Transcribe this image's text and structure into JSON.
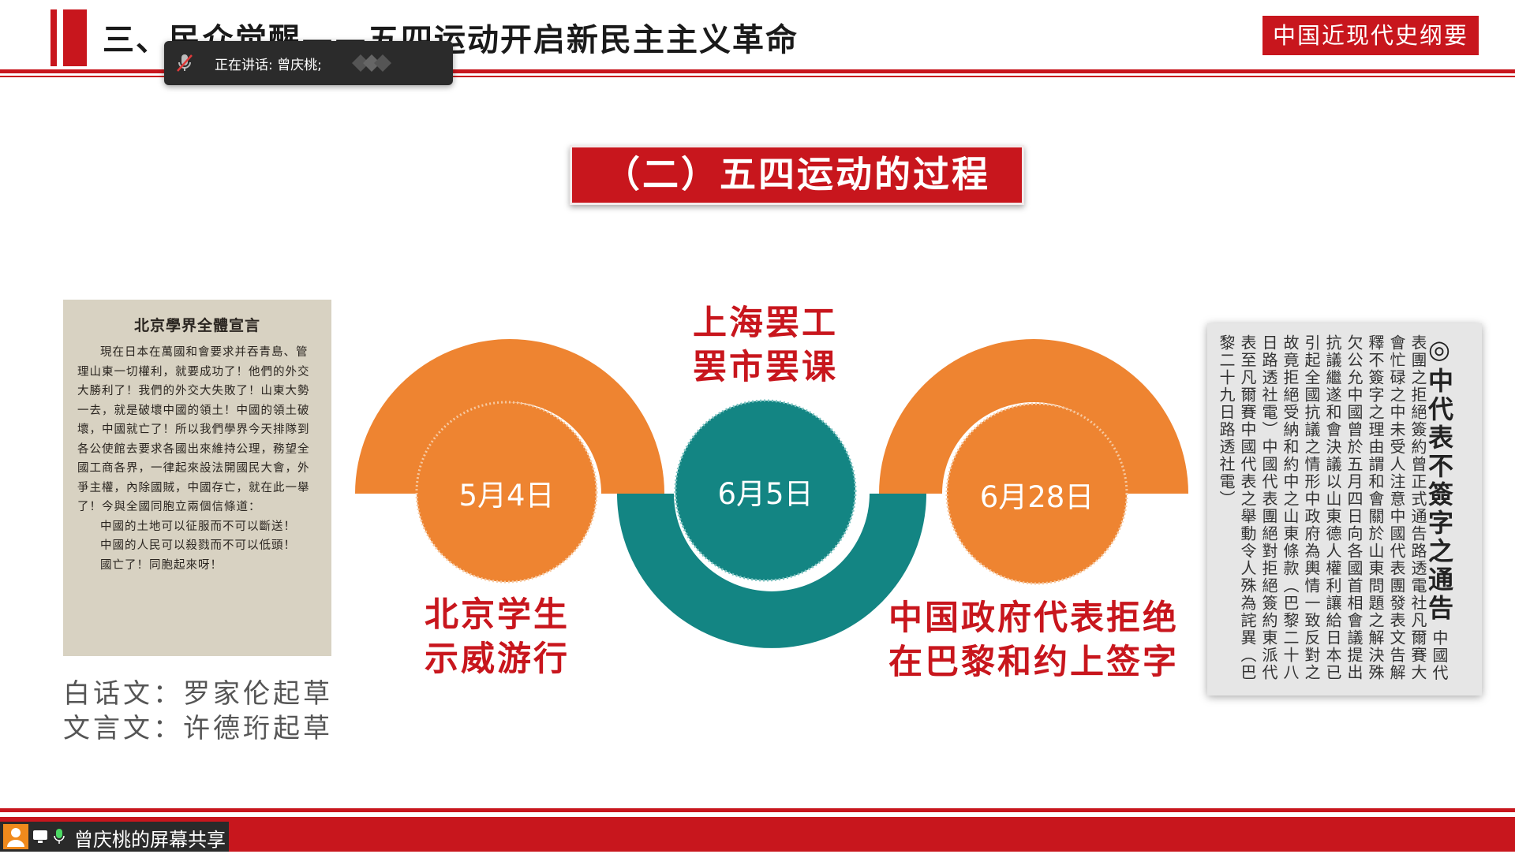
{
  "header": {
    "title": "三、民众觉醒——五四运动开启新民主主义革命",
    "brand": "中国近现代史纲要"
  },
  "toast": {
    "speaking": "正在讲话: 曾庆桃;",
    "mic_icon": "mic-muted-icon"
  },
  "section": {
    "heading": "（二）五四运动的过程"
  },
  "left_doc": {
    "title": "北京學界全體宣言",
    "body": "現在日本在萬國和會要求并吞青島、管理山東一切權利，就要成功了！他們的外交大勝利了！我們的外交大失敗了！山東大勢一去，就是破壞中國的領土！中國的領土破壞，中國就亡了！所以我們學界今天排隊到各公使館去要求各國出來維持公理，務望全國工商各界，一律起來設法開國民大會，外爭主權，內除國賊，中國存亡，就在此一舉了！今與全國同胞立兩個信條道：",
    "line1": "中國的土地可以征服而不可以斷送！",
    "line2": "中國的人民可以殺戮而不可以低頭！",
    "line3": "國亡了！同胞起來呀！"
  },
  "credits": {
    "line1": "白话文：罗家伦起草",
    "line2": "文言文：许德珩起草"
  },
  "timeline": {
    "events": [
      {
        "date": "5月4日",
        "label_line1": "北京学生",
        "label_line2": "示威游行"
      },
      {
        "date": "6月5日",
        "label_line1": "上海罢工",
        "label_line2": "罢市罢课"
      },
      {
        "date": "6月28日",
        "label_line1": "中国政府代表拒绝",
        "label_line2": "在巴黎和约上签字"
      }
    ],
    "colors": {
      "orange": "#ee8431",
      "teal": "#138583",
      "red": "#c8161d"
    }
  },
  "right_doc": {
    "title": "◎中代表不簽字之通告",
    "body": "中國代表團之拒絕簽約曾正式通告路透電社凡爾賽大會忙碌之中未受人注意中國代表團發表文告解釋不簽字之理由謂和會關於山東問題之解決殊欠公允中國曾於五月四日向各國首相會議提出抗議繼遂和會決議以山東德人權利讓給日本已引起全國抗議之情形中政府為輿情一致反對之故竟拒絕受納和約中之山東條款（巴黎二十八日路透社電）中國代表團絕對拒絕簽約東派代表至凡爾賽中國代表之舉動令人殊為詫異（巴黎二十九日路透社電）"
  },
  "share": {
    "label": "曾庆桃的屏幕共享"
  }
}
